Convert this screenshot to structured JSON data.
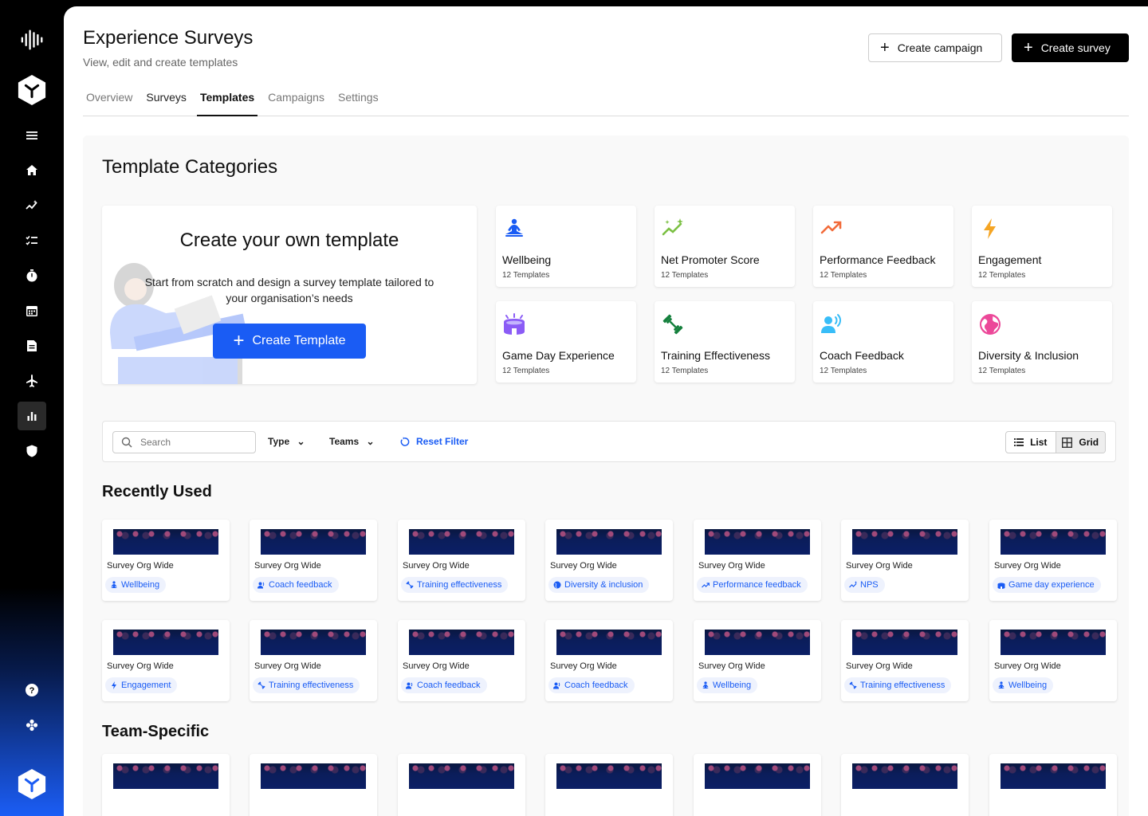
{
  "header": {
    "title": "Experience Surveys",
    "subtitle": "View, edit and create templates",
    "create_campaign": "Create campaign",
    "create_survey": "Create survey"
  },
  "tabs": [
    "Overview",
    "Surveys",
    "Templates",
    "Campaigns",
    "Settings"
  ],
  "active_tab": "Templates",
  "categories_section": {
    "title": "Template Categories",
    "own": {
      "title": "Create your own template",
      "description": "Start from scratch and design a survey template tailored to your organisation’s needs",
      "button": "Create Template"
    },
    "items": [
      {
        "name": "Wellbeing",
        "count": "12 Templates",
        "icon": "meditation-icon",
        "color": "#1a5cf4"
      },
      {
        "name": "Net Promoter Score",
        "count": "12 Templates",
        "icon": "trend-sparkle-icon",
        "color": "#7bc043"
      },
      {
        "name": "Performance Feedback",
        "count": "12 Templates",
        "icon": "trending-up-icon",
        "color": "#f26b3a"
      },
      {
        "name": "Engagement",
        "count": "12 Templates",
        "icon": "bolt-icon",
        "color": "#f5a524"
      },
      {
        "name": "Game Day Experience",
        "count": "12 Templates",
        "icon": "stadium-icon",
        "color": "#8b5cf6"
      },
      {
        "name": "Training Effectiveness",
        "count": "12 Templates",
        "icon": "dumbbell-icon",
        "color": "#15803d"
      },
      {
        "name": "Coach Feedback",
        "count": "12 Templates",
        "icon": "speaker-person-icon",
        "color": "#38bdf8"
      },
      {
        "name": "Diversity & Inclusion",
        "count": "12 Templates",
        "icon": "globe-icon",
        "color": "#ec4899"
      }
    ]
  },
  "filter": {
    "search_placeholder": "Search",
    "type_label": "Type",
    "teams_label": "Teams",
    "reset_label": "Reset Filter",
    "view_list": "List",
    "view_grid": "Grid"
  },
  "recently_used": {
    "title": "Recently Used",
    "rows": [
      [
        {
          "title": "Survey Org Wide",
          "tag": "Wellbeing",
          "tag_icon": "meditation-icon"
        },
        {
          "title": "Survey Org Wide",
          "tag": "Coach feedback",
          "tag_icon": "speaker-person-icon"
        },
        {
          "title": "Survey Org Wide",
          "tag": "Training effectiveness",
          "tag_icon": "dumbbell-icon"
        },
        {
          "title": "Survey Org Wide",
          "tag": "Diversity & inclusion",
          "tag_icon": "globe-icon"
        },
        {
          "title": "Survey Org Wide",
          "tag": "Performance feedback",
          "tag_icon": "trending-up-icon"
        },
        {
          "title": "Survey Org Wide",
          "tag": "NPS",
          "tag_icon": "trend-sparkle-icon"
        },
        {
          "title": "Survey Org Wide",
          "tag": "Game day experience",
          "tag_icon": "stadium-icon"
        }
      ],
      [
        {
          "title": "Survey Org Wide",
          "tag": "Engagement",
          "tag_icon": "bolt-icon"
        },
        {
          "title": "Survey Org Wide",
          "tag": "Training effectiveness",
          "tag_icon": "dumbbell-icon"
        },
        {
          "title": "Survey Org Wide",
          "tag": "Coach feedback",
          "tag_icon": "speaker-person-icon"
        },
        {
          "title": "Survey Org Wide",
          "tag": "Coach feedback",
          "tag_icon": "speaker-person-icon"
        },
        {
          "title": "Survey Org Wide",
          "tag": "Wellbeing",
          "tag_icon": "meditation-icon"
        },
        {
          "title": "Survey Org Wide",
          "tag": "Training effectiveness",
          "tag_icon": "dumbbell-icon"
        },
        {
          "title": "Survey Org Wide",
          "tag": "Wellbeing",
          "tag_icon": "meditation-icon"
        }
      ]
    ]
  },
  "team_specific": {
    "title": "Team-Specific"
  },
  "sidebar": {
    "items": [
      "waveform-logo-icon",
      "brand-logo-icon",
      "menu-icon",
      "home-icon",
      "analytics-icon",
      "checklist-icon",
      "timer-icon",
      "calendar-icon",
      "document-icon",
      "airplane-icon",
      "bar-chart-icon",
      "shield-icon",
      "help-icon",
      "apps-icon",
      "brand-logo-bottom-icon"
    ],
    "active": "bar-chart-icon"
  }
}
